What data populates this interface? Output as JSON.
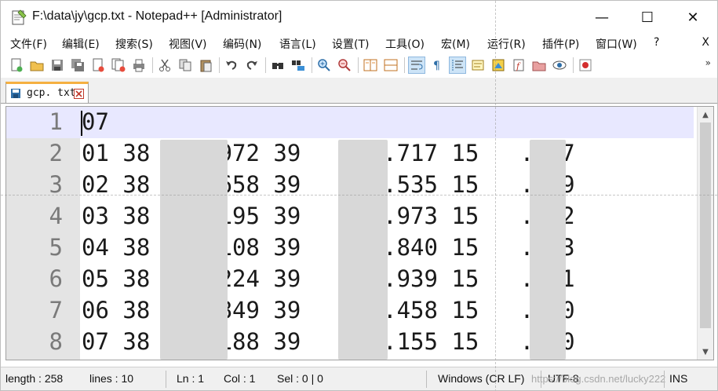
{
  "window": {
    "title": "F:\\data\\jy\\gcp.txt - Notepad++ [Administrator]",
    "controls": {
      "minimize": "—",
      "maximize": "☐",
      "close": "✕"
    }
  },
  "menu": {
    "items": [
      "文件(F)",
      "编辑(E)",
      "搜索(S)",
      "视图(V)",
      "编码(N)",
      "语言(L)",
      "设置(T)",
      "工具(O)",
      "宏(M)",
      "运行(R)",
      "插件(P)",
      "窗口(W)",
      "?"
    ],
    "close_doc": "X"
  },
  "toolbar": {
    "icons": [
      "new-file-icon",
      "open-file-icon",
      "save-icon",
      "save-all-icon",
      "close-icon",
      "close-all-icon",
      "print-icon",
      "cut-icon",
      "copy-icon",
      "paste-icon",
      "undo-icon",
      "redo-icon",
      "find-icon",
      "replace-icon",
      "zoom-in-icon",
      "zoom-out-icon",
      "sync-vertical-icon",
      "sync-horizontal-icon",
      "word-wrap-icon",
      "show-all-chars-icon",
      "indent-guide-icon",
      "user-language-icon",
      "document-map-icon",
      "function-list-icon",
      "folder-workspace-icon",
      "monitoring-icon",
      "record-macro-icon"
    ],
    "overflow": "»"
  },
  "tab": {
    "label": "gcp. txt"
  },
  "editor": {
    "lines": [
      {
        "num": "1",
        "text": "07"
      },
      {
        "num": "2",
        "text": "01 38    .972 39    63.717 15   .427"
      },
      {
        "num": "3",
        "text": "02 38    .658 39    52.535 15   .819"
      },
      {
        "num": "4",
        "text": "03 38    .195 39    83.973 15   .672"
      },
      {
        "num": "5",
        "text": "04 38    .108 39    94.840 15   .903"
      },
      {
        "num": "6",
        "text": "05 38    .224 39    77.939 15   .051"
      },
      {
        "num": "7",
        "text": "06 38    .849 39    29.458 15   .770"
      },
      {
        "num": "8",
        "text": "07 38    .188 39    70.155 15   .510"
      }
    ],
    "scroll": {
      "up": "▲",
      "down": "▼"
    }
  },
  "status": {
    "length": "length : 258",
    "lines": "lines : 10",
    "ln": "Ln : 1",
    "col": "Col : 1",
    "sel": "Sel : 0 | 0",
    "eol": "Windows (CR LF)",
    "encoding": "UTF-8",
    "mode": "INS",
    "watermark": "https://blog.csdn.net/lucky222"
  },
  "colors": {
    "current_line": "#e8e8ff",
    "gutter": "#e4e4e4",
    "tab_accent": "#f5b041",
    "status_bar": "#f0f0f0"
  }
}
